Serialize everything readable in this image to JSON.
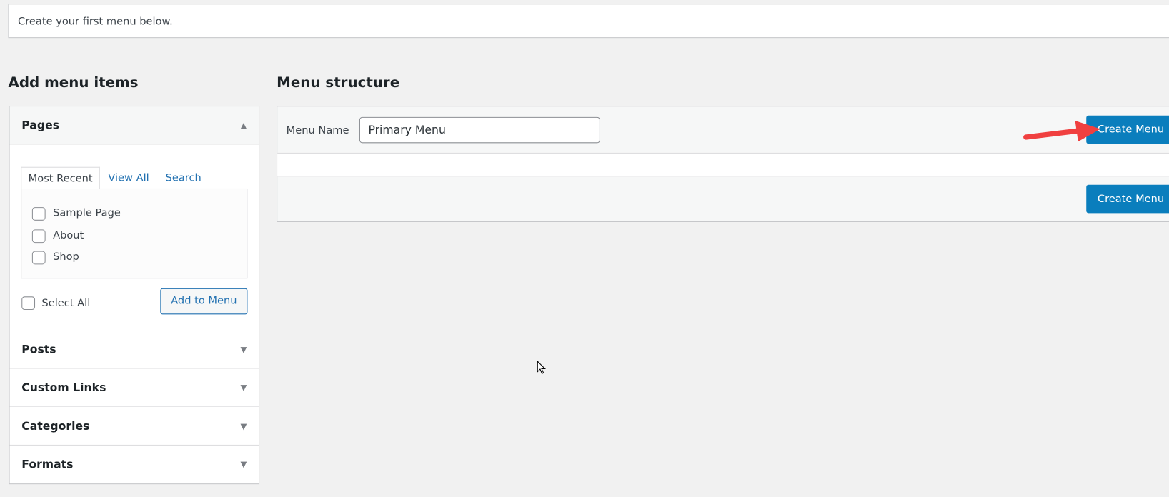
{
  "notice": "Create your first menu below.",
  "left": {
    "heading": "Add menu items",
    "pages": {
      "title": "Pages",
      "tabs": [
        "Most Recent",
        "View All",
        "Search"
      ],
      "items": [
        "Sample Page",
        "About",
        "Shop"
      ],
      "select_all": "Select All",
      "add_button": "Add to Menu"
    },
    "sections": [
      "Posts",
      "Custom Links",
      "Categories",
      "Formats"
    ]
  },
  "right": {
    "heading": "Menu structure",
    "menu_name_label": "Menu Name",
    "menu_name_value": "Primary Menu",
    "create_button_top": "Create Menu",
    "create_button_bottom": "Create Menu"
  },
  "colors": {
    "primary": "#0a7ebd",
    "link": "#2271b1",
    "arrow": "#f04040"
  }
}
